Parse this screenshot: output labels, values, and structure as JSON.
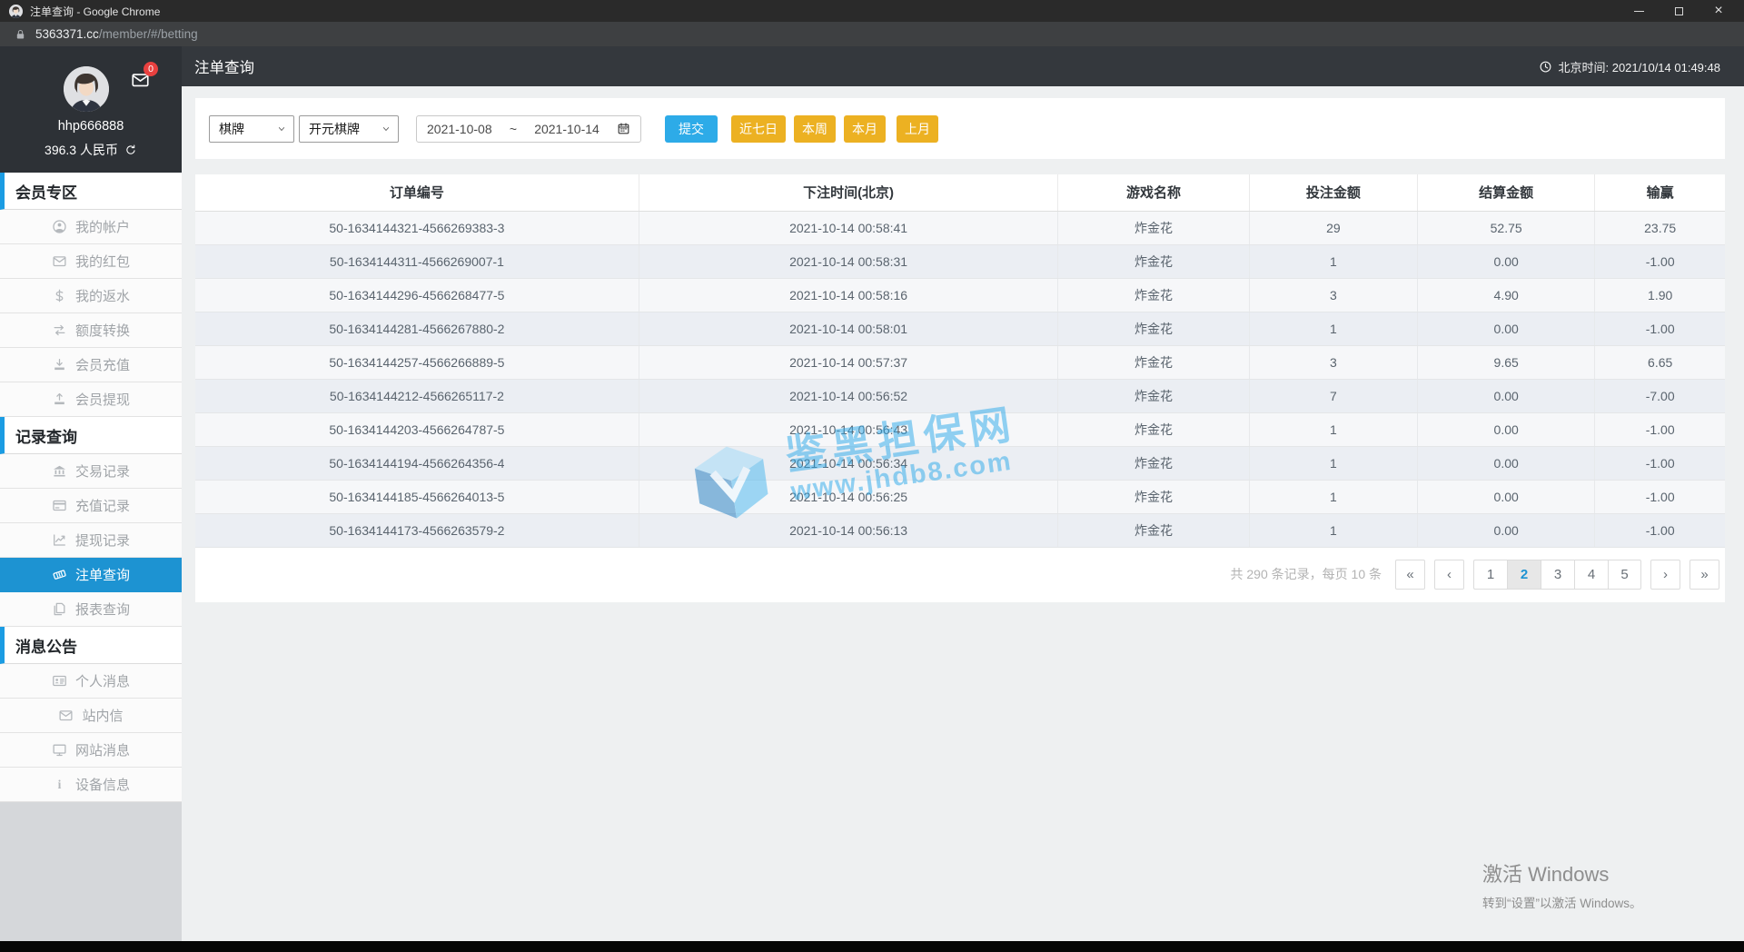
{
  "browser": {
    "title": "注单查询 - Google Chrome",
    "url_domain": "5363371.cc",
    "url_path": "/member/#/betting"
  },
  "header": {
    "page_title": "注单查询",
    "time_label": "北京时间: 2021/10/14 01:49:48"
  },
  "user": {
    "username": "hhp666888",
    "balance": "396.3 人民币",
    "mail_badge": "0"
  },
  "sidebar": {
    "sections": [
      {
        "label": "会员专区",
        "items": [
          {
            "label": "我的帐户"
          },
          {
            "label": "我的红包"
          },
          {
            "label": "我的返水"
          },
          {
            "label": "额度转换"
          },
          {
            "label": "会员充值"
          },
          {
            "label": "会员提现"
          }
        ]
      },
      {
        "label": "记录查询",
        "items": [
          {
            "label": "交易记录"
          },
          {
            "label": "充值记录"
          },
          {
            "label": "提现记录"
          },
          {
            "label": "注单查询",
            "active": true
          },
          {
            "label": "报表查询"
          }
        ]
      },
      {
        "label": "消息公告",
        "items": [
          {
            "label": "个人消息"
          },
          {
            "label": "站内信"
          },
          {
            "label": "网站消息"
          },
          {
            "label": "设备信息"
          }
        ]
      }
    ]
  },
  "filters": {
    "category_select": "棋牌",
    "game_select": "开元棋牌",
    "date_from": "2021-10-08",
    "date_separator": "~",
    "date_to": "2021-10-14",
    "submit": "提交",
    "quick_buttons": [
      "近七日",
      "本周",
      "本月",
      "上月"
    ]
  },
  "table": {
    "columns": [
      "订单编号",
      "下注时间(北京)",
      "游戏名称",
      "投注金额",
      "结算金额",
      "输赢"
    ],
    "rows": [
      [
        "50-1634144321-4566269383-3",
        "2021-10-14 00:58:41",
        "炸金花",
        "29",
        "52.75",
        "23.75"
      ],
      [
        "50-1634144311-4566269007-1",
        "2021-10-14 00:58:31",
        "炸金花",
        "1",
        "0.00",
        "-1.00"
      ],
      [
        "50-1634144296-4566268477-5",
        "2021-10-14 00:58:16",
        "炸金花",
        "3",
        "4.90",
        "1.90"
      ],
      [
        "50-1634144281-4566267880-2",
        "2021-10-14 00:58:01",
        "炸金花",
        "1",
        "0.00",
        "-1.00"
      ],
      [
        "50-1634144257-4566266889-5",
        "2021-10-14 00:57:37",
        "炸金花",
        "3",
        "9.65",
        "6.65"
      ],
      [
        "50-1634144212-4566265117-2",
        "2021-10-14 00:56:52",
        "炸金花",
        "7",
        "0.00",
        "-7.00"
      ],
      [
        "50-1634144203-4566264787-5",
        "2021-10-14 00:56:43",
        "炸金花",
        "1",
        "0.00",
        "-1.00"
      ],
      [
        "50-1634144194-4566264356-4",
        "2021-10-14 00:56:34",
        "炸金花",
        "1",
        "0.00",
        "-1.00"
      ],
      [
        "50-1634144185-4566264013-5",
        "2021-10-14 00:56:25",
        "炸金花",
        "1",
        "0.00",
        "-1.00"
      ],
      [
        "50-1634144173-4566263579-2",
        "2021-10-14 00:56:13",
        "炸金花",
        "1",
        "0.00",
        "-1.00"
      ]
    ]
  },
  "pagination": {
    "summary": "共 290 条记录，每页 10 条",
    "first": "«",
    "prev": "‹",
    "pages": [
      "1",
      "2",
      "3",
      "4",
      "5"
    ],
    "active_page": "2",
    "next": "›",
    "last": "»"
  },
  "watermark": {
    "line1": "鉴黑担保网",
    "line2": "www.jhdb8.com"
  },
  "activation": {
    "line1": "激活 Windows",
    "line2": "转到“设置”以激活 Windows。"
  },
  "colors": {
    "accent_blue": "#1d93d2",
    "submit_blue": "#2dabe8",
    "quick_yellow": "#ecb122",
    "badge_red": "#e8403f",
    "watermark_blue": "#2ba9ea"
  }
}
